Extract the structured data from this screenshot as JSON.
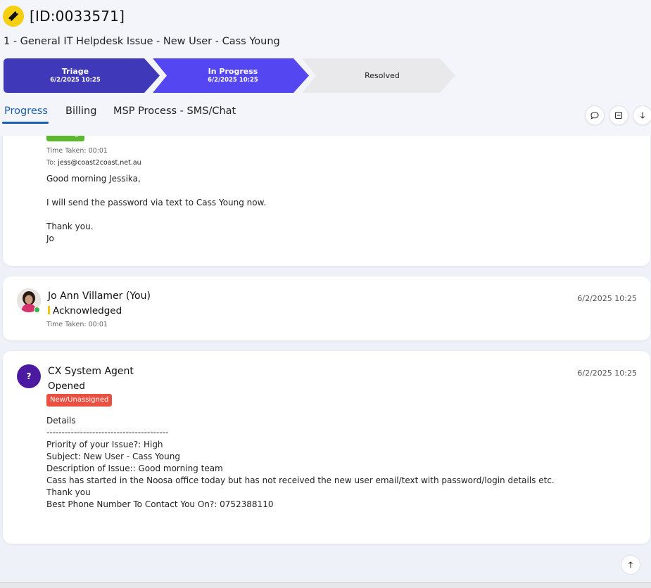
{
  "ticket": {
    "id": "[ID:0033571]",
    "title": "1 - General IT Helpdesk Issue - New User - Cass Young"
  },
  "pipeline": [
    {
      "label": "Triage",
      "date": "6/2/2025 10:25",
      "color": "#3f38b8"
    },
    {
      "label": "In Progress",
      "date": "6/2/2025 10:25",
      "color": "#5447f2"
    },
    {
      "label": "Resolved",
      "date": "",
      "color": "#e9e9ec"
    }
  ],
  "tabs": [
    {
      "label": "Progress",
      "active": true
    },
    {
      "label": "Billing",
      "active": false
    },
    {
      "label": "MSP Process - SMS/Chat",
      "active": false
    }
  ],
  "toolbar_icons": [
    "comment-icon",
    "collapse-icon",
    "download-arrow-icon"
  ],
  "feed": {
    "email_entry": {
      "badge": "Waiting",
      "time_taken": "Time Taken: 00:01",
      "to_label": "To:",
      "to_address": "jess@coast2coast.net.au",
      "body": "Good morning Jessika,\n\nI will send the password via text to Cass Young now.\n\nThank you.\nJo"
    },
    "ack_entry": {
      "author": "Jo Ann Villamer (You)",
      "status": "Acknowledged",
      "time_taken": "Time Taken: 00:01",
      "timestamp": "6/2/2025 10:25"
    },
    "opened_entry": {
      "avatar_letter": "?",
      "author": "CX System Agent",
      "status": "Opened",
      "badge": "New/Unassigned",
      "timestamp": "6/2/2025 10:25",
      "body": "Details\n----------------------------------------\nPriority of your Issue?: High\nSubject: New User - Cass Young\nDescription of Issue:: Good morning team\nCass has started in the Noosa office today but has not received the new user email/text with password/login details etc.\nThank you\nBest Phone Number To Contact You On?: 0752388110"
    }
  },
  "colors": {
    "accent": "#1a5fb4",
    "badge_green": "#5bb82f",
    "badge_red": "#e9503f",
    "ticket_icon": "#f5cf12",
    "agent_avatar": "#4b1aa0"
  }
}
